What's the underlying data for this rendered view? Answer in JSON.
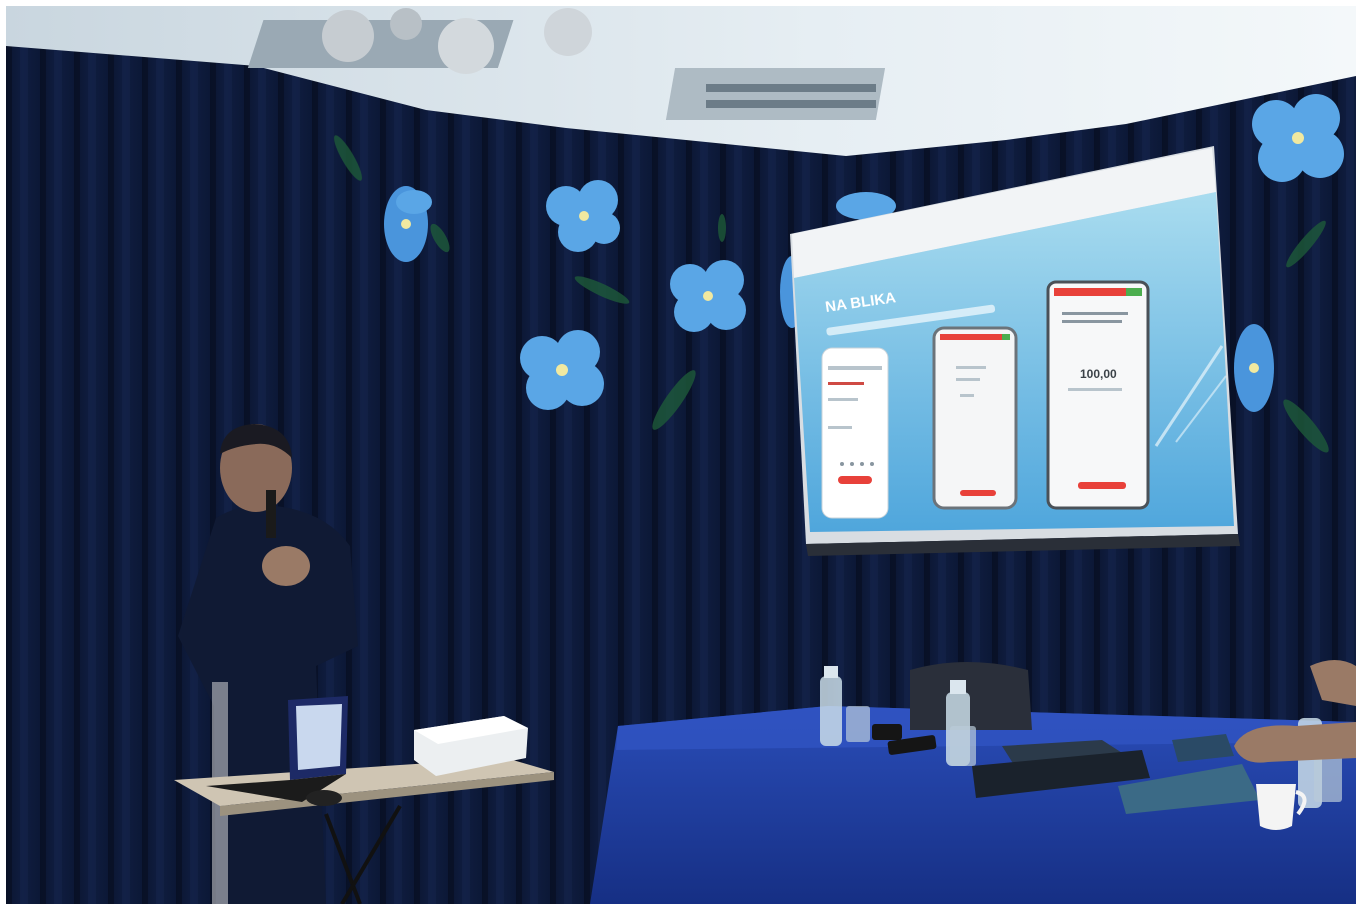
{
  "scene": {
    "type": "photograph",
    "subject": "presentation-room"
  },
  "slide": {
    "title": "NA BLIKA",
    "amount": "100,00"
  },
  "colors": {
    "curtain": "#0d1a38",
    "ceiling": "#dfe8ef",
    "screen_bg": "#7fc7e6",
    "tablecloth": "#1e3c9e",
    "flower": "#5aa6e6",
    "accent_red": "#e8413a"
  }
}
